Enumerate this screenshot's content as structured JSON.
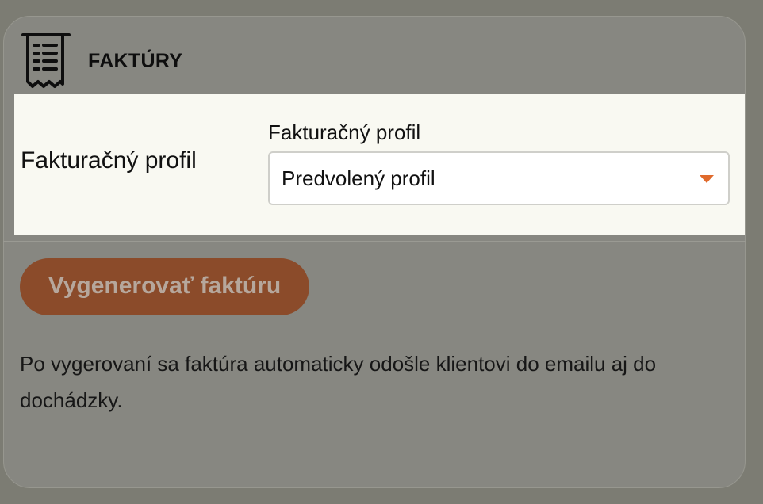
{
  "card": {
    "title": "FAKTÚRY",
    "icon": "receipt-icon"
  },
  "billing_profile": {
    "row_label": "Fakturačný profil",
    "field_label": "Fakturačný profil",
    "selected_value": "Predvolený profil",
    "caret_icon": "caret-down-icon",
    "caret_color": "#e06a2c"
  },
  "actions": {
    "generate_label": "Vygenerovať faktúru",
    "generate_color": "#8b4b2a"
  },
  "info": {
    "text": "Po vygerovaní sa faktúra automaticky odošle klientovi do emailu aj do dochádzky."
  },
  "colors": {
    "overlay": "#7c7c73",
    "highlight": "#f9f9f2"
  }
}
